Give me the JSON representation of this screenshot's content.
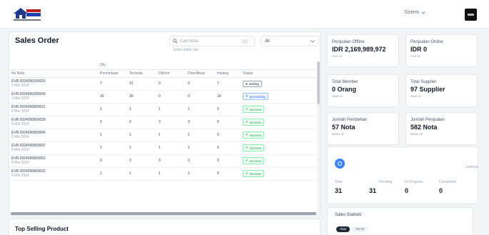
{
  "header": {
    "user_label": "Sistem",
    "user_chevron_icon": "chevron-down-icon"
  },
  "orders": {
    "title": "Sales Order",
    "search_placeholder": "Cari Nota",
    "search_hint": "Enter untuk cari",
    "filter_value": "All",
    "group_header": "Qty",
    "columns": [
      "No Nota",
      "Permintaan",
      "Tersedia",
      "Dikirim",
      "Diverifikasi",
      "Hutang",
      "Status"
    ],
    "rows": [
      {
        "no": "EVR.0024050300016",
        "date": "3 Mei 2024",
        "permintaan": "7",
        "tersedia": "12",
        "dikirim": "0",
        "diverifikasi": "0",
        "hutang": "7",
        "status": "waiting",
        "status_label": "waiting"
      },
      {
        "no": "EVR.0024050300043",
        "date": "3 Mei 2024",
        "permintaan": "16",
        "tersedia": "30",
        "dikirim": "0",
        "diverifikasi": "0",
        "hutang": "14",
        "status": "processing",
        "status_label": "processing"
      },
      {
        "no": "EVR.0024050800021",
        "date": "8 Mei 2024",
        "permintaan": "1",
        "tersedia": "1",
        "dikirim": "1",
        "diverifikasi": "1",
        "hutang": "0",
        "status": "success",
        "status_label": "success"
      },
      {
        "no": "EVR.0024050800039",
        "date": "8 Mei 2024",
        "permintaan": "3",
        "tersedia": "3",
        "dikirim": "3",
        "diverifikasi": "3",
        "hutang": "0",
        "status": "success",
        "status_label": "success"
      },
      {
        "no": "EVR.0024050800066",
        "date": "8 Mei 2024",
        "permintaan": "1",
        "tersedia": "1",
        "dikirim": "1",
        "diverifikasi": "1",
        "hutang": "0",
        "status": "success",
        "status_label": "success"
      },
      {
        "no": "EVR.0024050800097",
        "date": "8 Mei 2024",
        "permintaan": "1",
        "tersedia": "1",
        "dikirim": "1",
        "diverifikasi": "1",
        "hutang": "0",
        "status": "success",
        "status_label": "success"
      },
      {
        "no": "EVR.0024050800062",
        "date": "8 Mei 2024",
        "permintaan": "3",
        "tersedia": "3",
        "dikirim": "3",
        "diverifikasi": "3",
        "hutang": "0",
        "status": "success",
        "status_label": "success"
      },
      {
        "no": "EVR.0024050800032",
        "date": "8 Mei 2024",
        "permintaan": "1",
        "tersedia": "1",
        "dikirim": "1",
        "diverifikasi": "1",
        "hutang": "0",
        "status": "success",
        "status_label": "success"
      }
    ]
  },
  "top_selling": {
    "title": "Top Selling Product"
  },
  "cards": [
    {
      "title": "Penjualan Offline",
      "value": "IDR 2,169,989,972",
      "sub": "Hari ini"
    },
    {
      "title": "Penjualan Online",
      "value": "IDR 0",
      "sub": "Hari ini"
    },
    {
      "title": "Total Member",
      "value": "0 Orang",
      "sub": "Saat ini"
    },
    {
      "title": "Total Supplier",
      "value": "97 Supplier",
      "sub": "Saat ini"
    },
    {
      "title": "Jumlah Pembelian",
      "value": "57 Nota",
      "sub": "Bulan ini"
    },
    {
      "title": "Jumlah Penjualan",
      "value": "582 Nota",
      "sub": "Bulan ini"
    }
  ],
  "status_summary": {
    "link": "Lainnya",
    "items": [
      {
        "label": "Total",
        "value": "31"
      },
      {
        "label": "Pending",
        "value": "31"
      },
      {
        "label": "In Progress",
        "value": "0"
      },
      {
        "label": "Completed",
        "value": "0"
      }
    ]
  },
  "statistic": {
    "title": "Sales Statistic",
    "tabs": [
      "Year",
      "Month"
    ]
  },
  "colors": {
    "accent": "#3b82f6",
    "success": "#16a34a",
    "processing": "#2563eb"
  }
}
